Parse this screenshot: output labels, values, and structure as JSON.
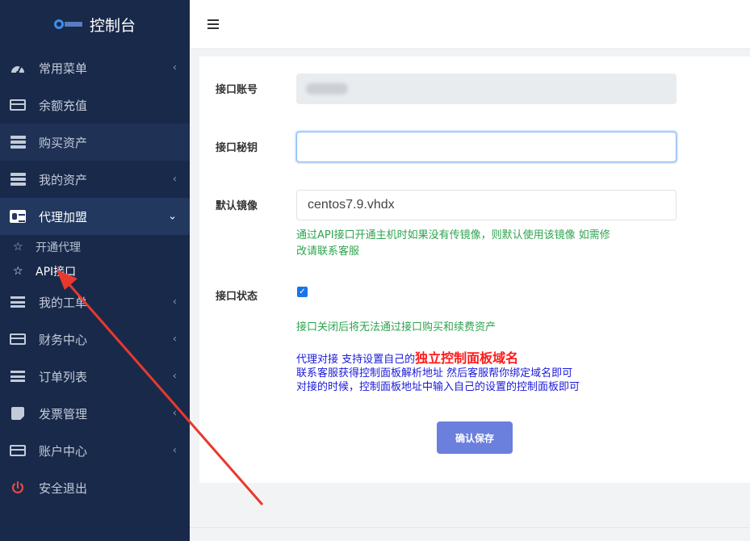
{
  "brand": {
    "title": "控制台"
  },
  "sidebar": {
    "items": [
      {
        "label": "常用菜单",
        "icon": "dashboard-icon",
        "chevron": "‹"
      },
      {
        "label": "余额充值",
        "icon": "credit-card-icon"
      },
      {
        "label": "购买资产",
        "icon": "server-icon"
      },
      {
        "label": "我的资产",
        "icon": "server-icon",
        "chevron": "‹"
      },
      {
        "label": "代理加盟",
        "icon": "id-card-icon",
        "chevron": "⌄"
      },
      {
        "label": "我的工单",
        "icon": "list-icon",
        "chevron": "‹"
      },
      {
        "label": "财务中心",
        "icon": "credit-card-icon",
        "chevron": "‹"
      },
      {
        "label": "订单列表",
        "icon": "list-icon",
        "chevron": "‹"
      },
      {
        "label": "发票管理",
        "icon": "note-icon",
        "chevron": "‹"
      },
      {
        "label": "账户中心",
        "icon": "id-card-icon",
        "chevron": "‹"
      },
      {
        "label": "安全退出",
        "icon": "power-icon"
      }
    ],
    "subitems": [
      {
        "label": "开通代理",
        "icon": "star-icon"
      },
      {
        "label": "API接口",
        "icon": "star-icon"
      }
    ]
  },
  "form": {
    "account_label": "接口账号",
    "account_value": "",
    "secret_label": "接口秘钥",
    "secret_value": "",
    "image_label": "默认镜像",
    "image_value": "centos7.9.vhdx",
    "image_hint_1": "通过API接口开通主机时如果没有传镜像，则默认使用该镜像 如需修",
    "image_hint_2": "改请联系客服",
    "status_label": "接口状态",
    "status_checked": true,
    "status_hint": "接口关闭后将无法通过接口购买和续费资产",
    "proxy_line_1a": "代理对接 支持设置自己的",
    "proxy_line_1b": "独立控制面板域名",
    "proxy_line_2": "联系客服获得控制面板解析地址 然后客服帮你绑定域名即可",
    "proxy_line_3": "对接的时候，控制面板地址中输入自己的设置的控制面板即可",
    "save_label": "确认保存"
  },
  "colors": {
    "sidebar_bg": "#19294a",
    "accent_button": "#6b7fdd",
    "hint_green": "#2ea44f",
    "hint_blue": "#1a1adb",
    "emphasis_red": "#ff1a1a",
    "arrow_red": "#e8392e"
  }
}
